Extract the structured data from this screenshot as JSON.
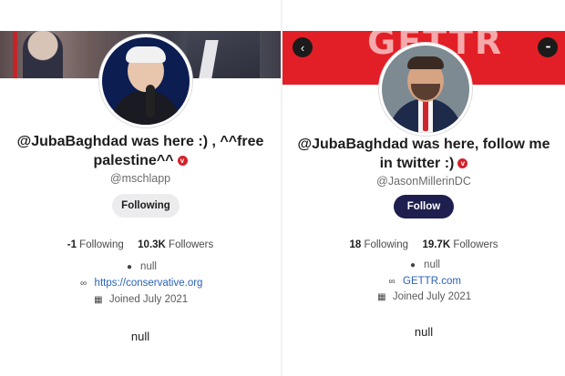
{
  "colors": {
    "gettr_red": "#e21f26",
    "verified_badge": "#d2212a",
    "follow_button": "#1e1f4f",
    "following_button": "#ececef",
    "link": "#2a62b5"
  },
  "left_profile": {
    "display_name": "@JubaBaghdad was here :) , ^^free palestine^^",
    "verified_icon": "verified-badge-icon",
    "verified_glyph": "v",
    "handle": "@mschlapp",
    "action_button": "Following",
    "following_count": "-1",
    "following_label": "Following",
    "followers_count": "10.3K",
    "followers_label": "Followers",
    "location": "null",
    "website": "https://conservative.org",
    "joined": "Joined July 2021",
    "bio": "null"
  },
  "right_profile": {
    "banner_brand": "GETTR",
    "back_icon": "back-arrow-icon",
    "back_glyph": "‹",
    "menu_icon": "more-options-icon",
    "menu_glyph": "•••",
    "display_name": "@JubaBaghdad was here, follow me in twitter :)",
    "verified_icon": "verified-badge-icon",
    "verified_glyph": "v",
    "handle": "@JasonMillerinDC",
    "action_button": "Follow",
    "following_count": "18",
    "following_label": "Following",
    "followers_count": "19.7K",
    "followers_label": "Followers",
    "location": "null",
    "website": "GETTR.com",
    "joined": "Joined July 2021",
    "bio": "null"
  },
  "icons": {
    "location": "location-pin-icon",
    "link": "link-icon",
    "calendar": "calendar-icon"
  }
}
